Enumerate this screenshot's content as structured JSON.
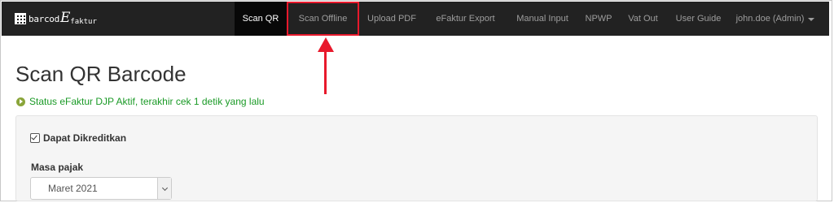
{
  "brand": {
    "prefix": "barcod",
    "big": "E",
    "suffix": "faktur"
  },
  "nav": {
    "items": [
      {
        "label": "Scan QR"
      },
      {
        "label": "Scan Offline"
      },
      {
        "label": "Upload PDF"
      },
      {
        "label": "eFaktur Export"
      },
      {
        "label": "Manual Input"
      },
      {
        "label": "NPWP"
      },
      {
        "label": "Vat Out"
      },
      {
        "label": "User Guide"
      }
    ],
    "user": "john.doe (Admin)"
  },
  "page": {
    "title": "Scan QR Barcode",
    "status": "Status eFaktur DJP Aktif, terakhir cek 1 detik yang lalu"
  },
  "form": {
    "checkbox_label": "Dapat Dikreditkan",
    "checkbox_checked": true,
    "masa_label": "Masa pajak",
    "masa_value": "Maret 2021"
  },
  "colors": {
    "highlight": "#e8192c",
    "navbar": "#222222",
    "status": "#1a9a26"
  }
}
